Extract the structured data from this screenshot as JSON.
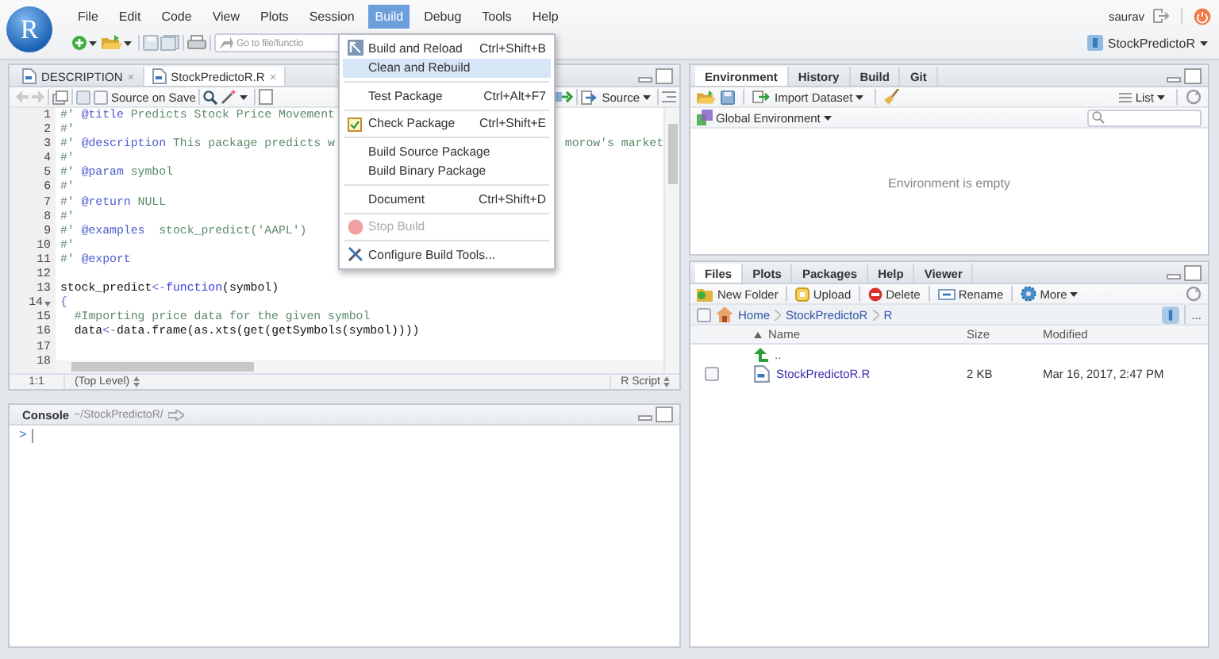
{
  "logo": {
    "letter": "R"
  },
  "menu": [
    {
      "label": "File",
      "selected": false
    },
    {
      "label": "Edit",
      "selected": false
    },
    {
      "label": "Code",
      "selected": false
    },
    {
      "label": "View",
      "selected": false
    },
    {
      "label": "Plots",
      "selected": false
    },
    {
      "label": "Session",
      "selected": false
    },
    {
      "label": "Build",
      "selected": true
    },
    {
      "label": "Debug",
      "selected": false
    },
    {
      "label": "Tools",
      "selected": false
    },
    {
      "label": "Help",
      "selected": false
    }
  ],
  "user": {
    "name": "saurav"
  },
  "project": {
    "name": "StockPredictoR"
  },
  "goto_field": {
    "placeholder": "Go to file/functio"
  },
  "build_menu": [
    {
      "kind": "item",
      "label": "Build and Reload",
      "shortcut": "Ctrl+Shift+B",
      "highlighted": false,
      "disabled": false
    },
    {
      "kind": "item",
      "label": "Clean and Rebuild",
      "highlighted": true,
      "disabled": false
    },
    {
      "kind": "separator"
    },
    {
      "kind": "item",
      "label": "Test Package",
      "shortcut": "Ctrl+Alt+F7",
      "highlighted": false,
      "disabled": false
    },
    {
      "kind": "separator"
    },
    {
      "kind": "item",
      "label": "Check Package",
      "shortcut": "Ctrl+Shift+E",
      "highlighted": false,
      "disabled": false
    },
    {
      "kind": "separator"
    },
    {
      "kind": "item",
      "label": "Build Source Package",
      "highlighted": false,
      "disabled": false
    },
    {
      "kind": "item",
      "label": "Build Binary Package",
      "highlighted": false,
      "disabled": false
    },
    {
      "kind": "separator"
    },
    {
      "kind": "item",
      "label": "Document",
      "shortcut": "Ctrl+Shift+D",
      "highlighted": false,
      "disabled": false
    },
    {
      "kind": "separator"
    },
    {
      "kind": "item",
      "label": "Stop Build",
      "highlighted": false,
      "disabled": true
    },
    {
      "kind": "separator"
    },
    {
      "kind": "item",
      "label": "Configure Build Tools...",
      "highlighted": false,
      "disabled": false
    }
  ],
  "editor": {
    "tabs": [
      {
        "label": "DESCRIPTION",
        "close": "×",
        "selected": false
      },
      {
        "label": "StockPredictoR.R",
        "close": "×",
        "selected": true
      }
    ],
    "source_on_save": {
      "label": "Source on Save",
      "checked": false
    },
    "source_button": {
      "label": "Source"
    },
    "lines": [
      {
        "number": "1",
        "segments": [
          {
            "kind": "comment",
            "text": "#' "
          },
          {
            "kind": "tag",
            "text": "@title"
          },
          {
            "kind": "comment",
            "text": " Predicts Stock Price Movement"
          }
        ]
      },
      {
        "number": "2",
        "segments": [
          {
            "kind": "comment",
            "text": "#'"
          }
        ]
      },
      {
        "number": "3",
        "segments": [
          {
            "kind": "comment",
            "text": "#' "
          },
          {
            "kind": "tag",
            "text": "@description"
          },
          {
            "kind": "comment",
            "text": " This package predicts w"
          }
        ],
        "tail": "morow's market"
      },
      {
        "number": "4",
        "segments": [
          {
            "kind": "comment",
            "text": "#'"
          }
        ]
      },
      {
        "number": "5",
        "segments": [
          {
            "kind": "comment",
            "text": "#' "
          },
          {
            "kind": "tag",
            "text": "@param"
          },
          {
            "kind": "comment",
            "text": " symbol"
          }
        ]
      },
      {
        "number": "6",
        "segments": [
          {
            "kind": "comment",
            "text": "#'"
          }
        ]
      },
      {
        "number": "7",
        "segments": [
          {
            "kind": "comment",
            "text": "#' "
          },
          {
            "kind": "tag",
            "text": "@return"
          },
          {
            "kind": "comment",
            "text": " NULL"
          }
        ]
      },
      {
        "number": "8",
        "segments": [
          {
            "kind": "comment",
            "text": "#'"
          }
        ]
      },
      {
        "number": "9",
        "segments": [
          {
            "kind": "comment",
            "text": "#' "
          },
          {
            "kind": "tag",
            "text": "@examples"
          },
          {
            "kind": "comment",
            "text": "  stock_predict('AAPL')"
          }
        ]
      },
      {
        "number": "10",
        "segments": [
          {
            "kind": "comment",
            "text": "#'"
          }
        ]
      },
      {
        "number": "11",
        "segments": [
          {
            "kind": "comment",
            "text": "#' "
          },
          {
            "kind": "tag",
            "text": "@export"
          }
        ]
      },
      {
        "number": "12"
      },
      {
        "number": "13",
        "segments": [
          {
            "kind": "code",
            "text": "stock_predict"
          },
          {
            "kind": "operator",
            "text": "<-"
          },
          {
            "kind": "keyword",
            "text": "function"
          },
          {
            "kind": "code",
            "text": "(symbol)"
          }
        ]
      },
      {
        "number": "14",
        "foldable": true,
        "segments": [
          {
            "kind": "operator",
            "text": "{"
          }
        ]
      },
      {
        "number": "15",
        "segments": [
          {
            "kind": "comment",
            "text": "  #Importing price data for the given symbol"
          }
        ]
      },
      {
        "number": "16",
        "segments": [
          {
            "kind": "code",
            "text": "  data"
          },
          {
            "kind": "operator",
            "text": "<-"
          },
          {
            "kind": "code",
            "text": "data.frame(as.xts(get(getSymbols(symbol))))"
          }
        ]
      },
      {
        "number": "17"
      },
      {
        "number": "18"
      }
    ],
    "status": {
      "position": "1:1",
      "scope": "(Top Level)",
      "file_type": "R Script"
    }
  },
  "console": {
    "title": "Console",
    "path": "~/StockPredictoR/",
    "prompt": ">"
  },
  "environment": {
    "tabs": [
      {
        "label": "Environment",
        "selected": true
      },
      {
        "label": "History",
        "selected": false
      },
      {
        "label": "Build",
        "selected": false
      },
      {
        "label": "Git",
        "selected": false
      }
    ],
    "import_button": "Import Dataset",
    "view_button": "List",
    "scope": "Global Environment",
    "empty_message": "Environment is empty"
  },
  "files": {
    "tabs": [
      {
        "label": "Files",
        "selected": true
      },
      {
        "label": "Plots",
        "selected": false
      },
      {
        "label": "Packages",
        "selected": false
      },
      {
        "label": "Help",
        "selected": false
      },
      {
        "label": "Viewer",
        "selected": false
      }
    ],
    "toolbar": [
      "New Folder",
      "Upload",
      "Delete",
      "Rename",
      "More"
    ],
    "select_all": {
      "checked": false
    },
    "breadcrumb": [
      "Home",
      "StockPredictoR",
      "R"
    ],
    "more_button": "...",
    "columns": [
      "Name",
      "Size",
      "Modified"
    ],
    "parent_row": "..",
    "rows": [
      {
        "name": "StockPredictoR.R",
        "size": "2 KB",
        "modified": "Mar 16, 2017, 2:47 PM",
        "checked": false
      }
    ]
  }
}
